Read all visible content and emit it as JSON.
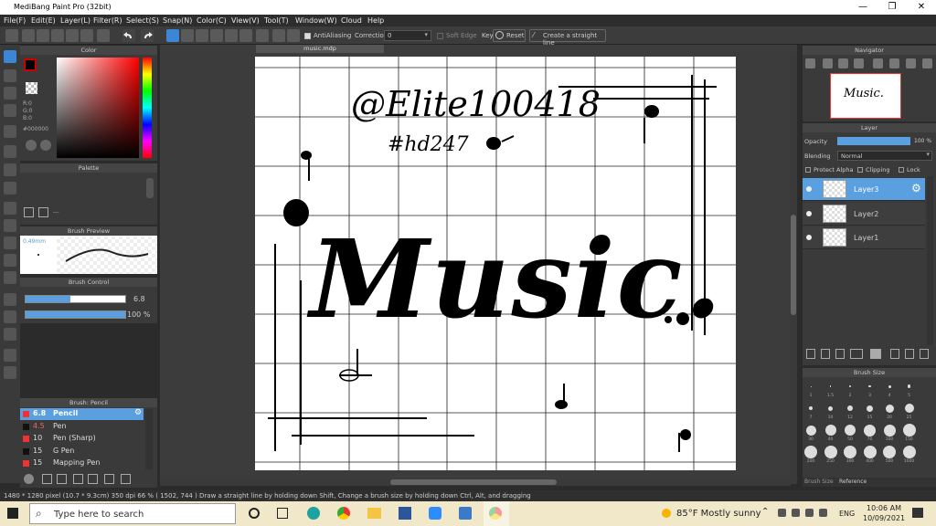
{
  "window": {
    "title": "MediBang Paint Pro (32bit)",
    "controls": [
      "—",
      "❐",
      "✕"
    ]
  },
  "menu": [
    "File(F)",
    "Edit(E)",
    "Layer(L)",
    "Filter(R)",
    "Select(S)",
    "Snap(N)",
    "Color(C)",
    "View(V)",
    "Tool(T)",
    "Window(W)",
    "Cloud",
    "Help"
  ],
  "toolbar": {
    "antialiasing": "AntiAliasing",
    "correction_label": "Correction",
    "correction_value": "0",
    "soft_edge": "Soft Edge",
    "key": "Key",
    "reset": "Reset",
    "straight_line": "Create a straight line"
  },
  "color_panel": {
    "title": "Color",
    "r": "R:0",
    "g": "G:0",
    "b": "B:0",
    "hex": "#000000"
  },
  "palette_panel": {
    "title": "Palette",
    "value": "---"
  },
  "brush_preview": {
    "title": "Brush Preview",
    "size": "0.49mm"
  },
  "brush_control": {
    "title": "Brush Control",
    "size_value": "6.8",
    "opacity_value": "100 %",
    "size_fraction": 0.45,
    "opacity_fraction": 1.0
  },
  "brush_list": {
    "title": "Brush: Pencil",
    "items": [
      {
        "size": "6.8",
        "name": "Pencil",
        "selected": true
      },
      {
        "size": "4.5",
        "name": "Pen",
        "selected": false
      },
      {
        "size": "10",
        "name": "Pen (Sharp)",
        "selected": false
      },
      {
        "size": "15",
        "name": "G Pen",
        "selected": false
      },
      {
        "size": "15",
        "name": "Mapping Pen",
        "selected": false
      }
    ]
  },
  "document": {
    "tab": "music.mdp",
    "art": {
      "handle": "@Elite100418",
      "tag": "#hd247",
      "word": "Music."
    }
  },
  "navigator": {
    "title": "Navigator",
    "thumb_text": "Music."
  },
  "layer_panel": {
    "title": "Layer",
    "opacity_label": "Opacity",
    "opacity_value": "100 %",
    "blending_label": "Blending",
    "blending_value": "Normal",
    "protect_alpha": "Protect Alpha",
    "clipping": "Clipping",
    "lock": "Lock",
    "layers": [
      {
        "name": "Layer3",
        "selected": true
      },
      {
        "name": "Layer2",
        "selected": false
      },
      {
        "name": "Layer1",
        "selected": false
      }
    ]
  },
  "brush_size_panel": {
    "title": "Brush Size",
    "tabs": [
      "Brush Size",
      "Reference"
    ],
    "row1": [
      "1",
      "1.5",
      "2",
      "3",
      "4",
      "5"
    ],
    "row2": [
      "7",
      "10",
      "12",
      "15",
      "20",
      "25"
    ],
    "row3": [
      "30",
      "40",
      "50",
      "70",
      "100",
      "150"
    ],
    "row4": [
      "200",
      "250",
      "300",
      "400",
      "500",
      "1000"
    ]
  },
  "status": {
    "text": "1480 * 1280 pixel   (10.7 * 9.3cm)   350 dpi   66 %   ( 1502, 744 )   Draw a straight line by holding down Shift, Change a brush size by holding down Ctrl, Alt, and dragging"
  },
  "taskbar": {
    "search_placeholder": "Type here to search",
    "weather": "85°F  Mostly sunny",
    "lang": "ENG",
    "time": "10:06 AM",
    "date": "10/09/2021"
  }
}
